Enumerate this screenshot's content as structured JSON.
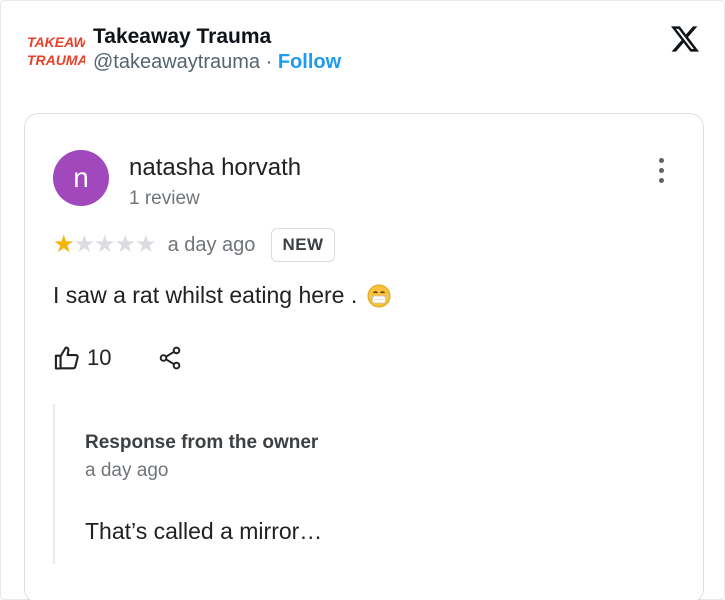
{
  "post": {
    "account_name": "Takeaway Trauma",
    "handle": "@takeawaytrauma",
    "separator": " · ",
    "follow_label": "Follow",
    "logo_text": "TAKEAWAY TRAUMA",
    "logo_line1": "TAKEAWAY",
    "logo_line2": "TRAUMA",
    "platform_icon": "x-logo-icon"
  },
  "review": {
    "avatar_letter": "n",
    "avatar_color": "#a148bc",
    "reviewer_name": "natasha horvath",
    "review_count": "1 review",
    "rating": 1,
    "rating_max": 5,
    "time": "a day ago",
    "badge": "NEW",
    "text": "I saw a rat whilst eating here .",
    "emoji": "grimacing-face-with-mask-icon",
    "likes": "10"
  },
  "owner_response": {
    "title": "Response from the owner",
    "time": "a day ago",
    "text": "That’s called a mirror…"
  },
  "colors": {
    "follow": "#1d9bf0",
    "star_on": "#f4b400",
    "star_off": "#dadce0"
  }
}
